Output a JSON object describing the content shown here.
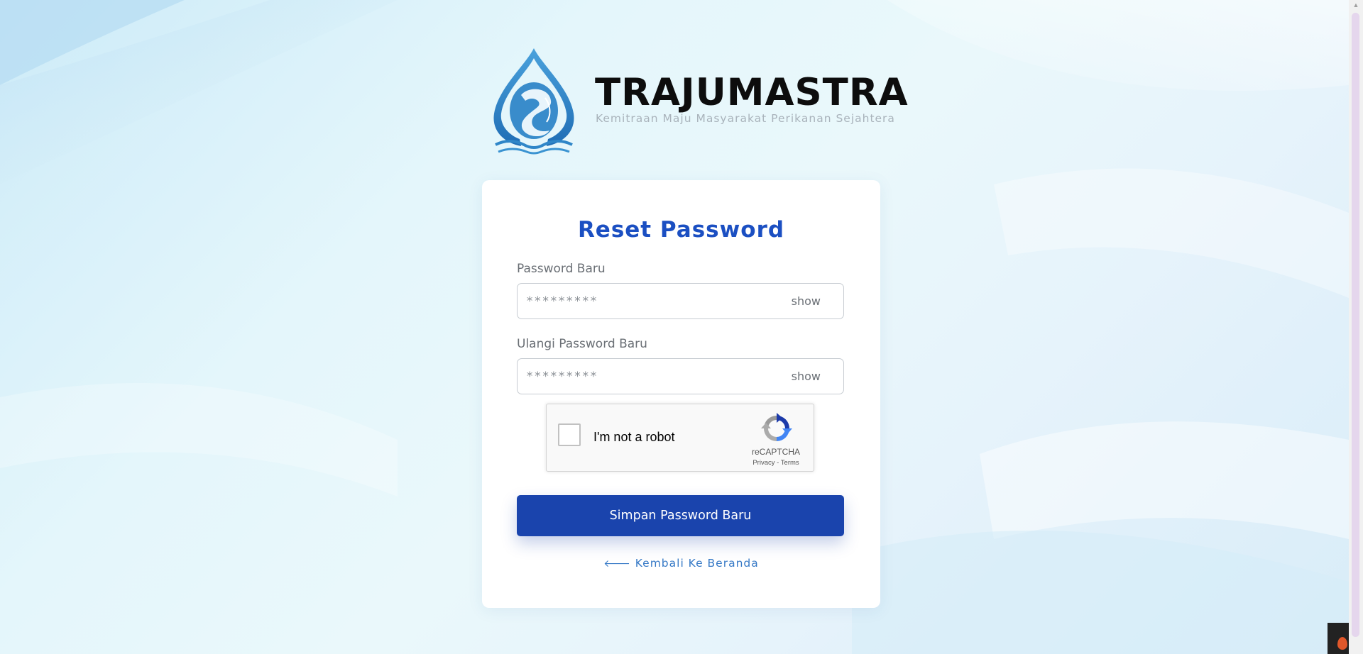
{
  "brand": {
    "name": "TRAJUMASTRA",
    "tagline": "Kemitraan Maju Masyarakat Perikanan Sejahtera",
    "logo_icon": "fish-droplet-logo"
  },
  "form": {
    "title": "Reset Password",
    "new_password": {
      "label": "Password Baru",
      "placeholder": "*********",
      "toggle_label": "show"
    },
    "confirm_password": {
      "label": "Ulangi Password Baru",
      "placeholder": "*********",
      "toggle_label": "show"
    },
    "recaptcha": {
      "label": "I'm not a robot",
      "brand": "reCAPTCHA",
      "privacy": "Privacy",
      "separator": "-",
      "terms": "Terms"
    },
    "submit_label": "Simpan Password Baru",
    "back_link": {
      "arrow": "🡐",
      "label": "Kembali Ke Beranda"
    }
  },
  "colors": {
    "primary": "#1a44ad",
    "title": "#1b4fc2",
    "link": "#3679c6",
    "logo_blue": "#2f86c8"
  }
}
